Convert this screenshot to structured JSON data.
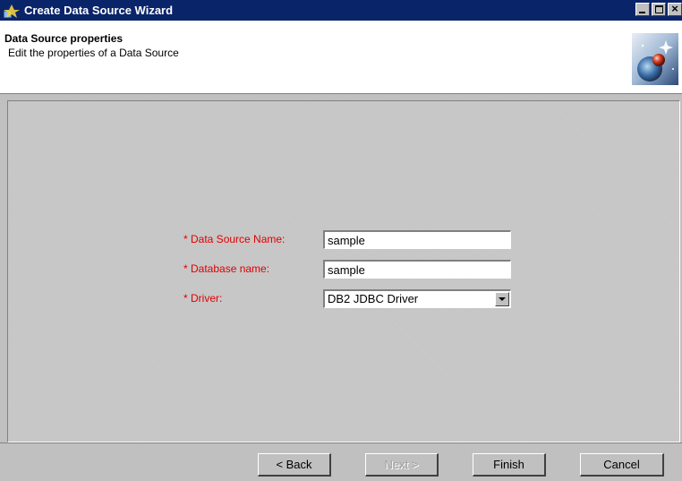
{
  "window": {
    "title": "Create Data Source Wizard"
  },
  "header": {
    "title": "Data Source properties",
    "description": "Edit the properties of a Data Source"
  },
  "form": {
    "data_source_name": {
      "label": "* Data Source Name:",
      "value": "sample"
    },
    "database_name": {
      "label": "* Database name:",
      "value": "sample"
    },
    "driver": {
      "label": "* Driver:",
      "selected": "DB2 JDBC Driver"
    }
  },
  "buttons": {
    "back": "< Back",
    "next": "Next >",
    "finish": "Finish",
    "cancel": "Cancel"
  },
  "colors": {
    "titlebar": "#0a246a",
    "required_label": "#e00000",
    "panel": "#c6c6c6"
  },
  "icons": {
    "app": "wizard-app-icon",
    "header": "globe-sparkle-icon"
  }
}
